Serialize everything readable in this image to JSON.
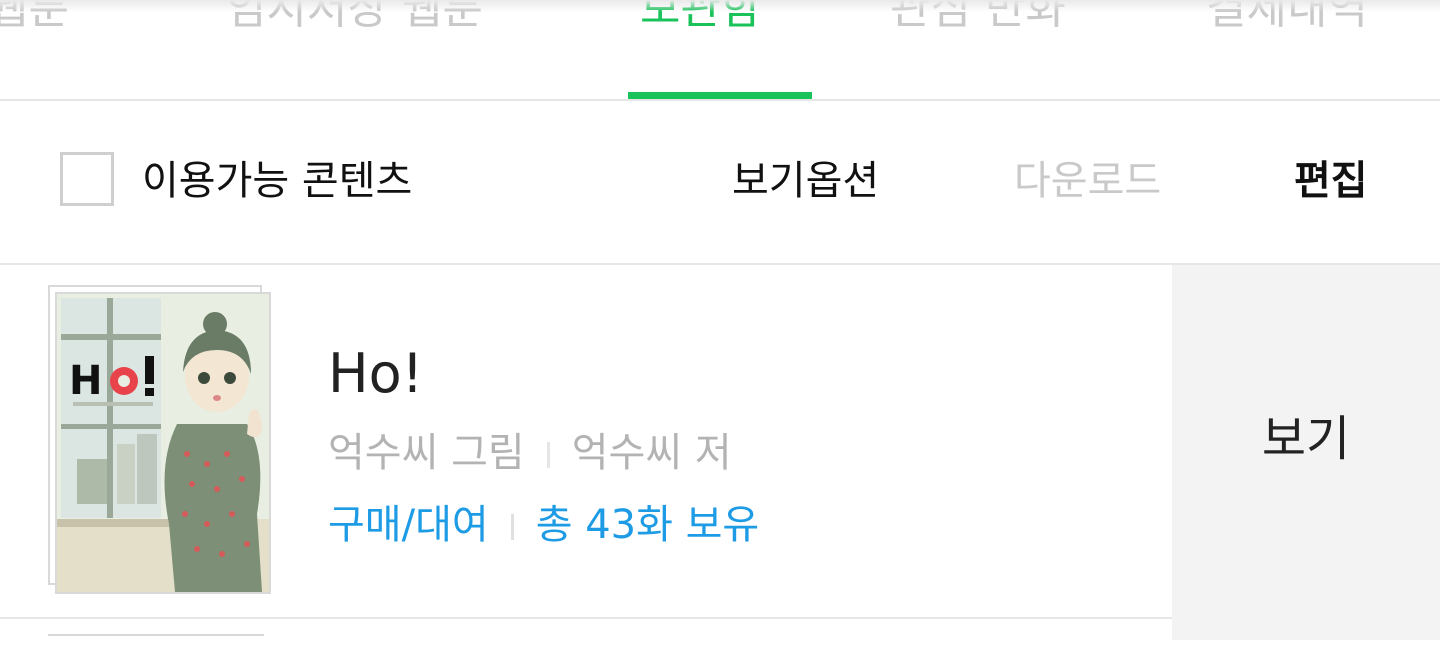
{
  "tabs": [
    {
      "label": "웹툰",
      "active": false
    },
    {
      "label": "임시저장 웹툰",
      "active": false
    },
    {
      "label": "보관함",
      "active": true
    },
    {
      "label": "관심 만화",
      "active": false
    },
    {
      "label": "결제내역",
      "active": false
    }
  ],
  "colors": {
    "accent": "#19c35a",
    "link": "#1e9be5",
    "muted": "#b3b3b3"
  },
  "toolbar": {
    "available_content": "이용가능 콘텐츠",
    "view_options": "보기옵션",
    "download": "다운로드",
    "edit": "편집"
  },
  "items": [
    {
      "thumbnail_icon": "comic-cover-ho-image",
      "cover_text": "Ho!",
      "title": "Ho!",
      "artist": "억수씨 그림",
      "writer": "억수씨 저",
      "purchase": "구매/대여",
      "owned": "총 43화 보유",
      "view_button": "보기"
    }
  ]
}
